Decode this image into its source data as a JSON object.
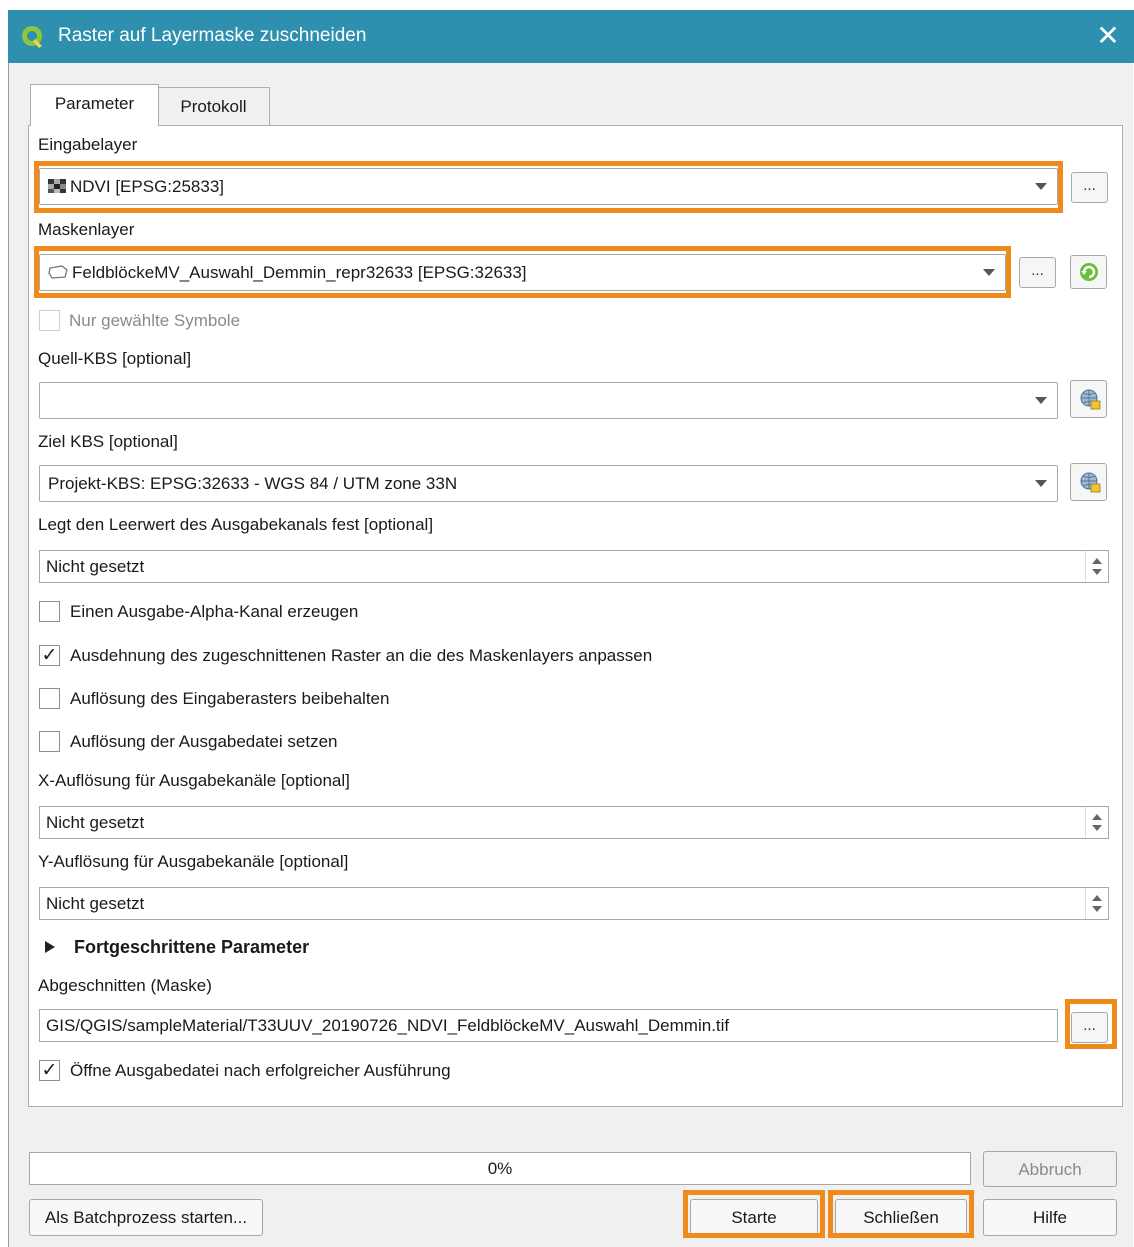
{
  "window": {
    "title": "Raster auf Layermaske zuschneiden",
    "close_glyph": "✕",
    "app_icon": "qgis-logo-icon"
  },
  "tabs": [
    {
      "label": "Parameter",
      "active": true
    },
    {
      "label": "Protokoll",
      "active": false
    }
  ],
  "params": {
    "input_layer": {
      "label": "Eingabelayer",
      "value": "NDVI [EPSG:25833]",
      "icon": "raster-layer-icon"
    },
    "mask_layer": {
      "label": "Maskenlayer",
      "value": "FeldblöckeMV_Auswahl_Demmin_repr32633 [EPSG:32633]",
      "icon": "polygon-layer-icon"
    },
    "selected_only": {
      "label": "Nur gewählte Symbole",
      "checked": false,
      "enabled": false
    },
    "source_crs": {
      "label": "Quell-KBS [optional]",
      "value": ""
    },
    "target_crs": {
      "label": "Ziel KBS [optional]",
      "value": "Projekt-KBS: EPSG:32633 - WGS 84 / UTM zone 33N"
    },
    "nodata": {
      "label": "Legt den Leerwert des Ausgabekanals fest [optional]",
      "value": "Nicht gesetzt"
    },
    "alpha": {
      "label": "Einen Ausgabe-Alpha-Kanal erzeugen",
      "checked": false
    },
    "crop_extent": {
      "label": "Ausdehnung des zugeschnittenen Raster an die des Maskenlayers anpassen",
      "checked": true
    },
    "keep_resolution": {
      "label": "Auflösung des Eingaberasters beibehalten",
      "checked": false
    },
    "set_resolution": {
      "label": "Auflösung der Ausgabedatei setzen",
      "checked": false
    },
    "x_res": {
      "label": "X-Auflösung für Ausgabekanäle [optional]",
      "value": "Nicht gesetzt"
    },
    "y_res": {
      "label": "Y-Auflösung für Ausgabekanäle [optional]",
      "value": "Nicht gesetzt"
    },
    "advanced": {
      "label": "Fortgeschrittene Parameter"
    },
    "output": {
      "label": "Abgeschnitten (Maske)",
      "value": "GIS/QGIS/sampleMaterial/T33UUV_20190726_NDVI_FeldblöckeMV_Auswahl_Demmin.tif"
    },
    "open_output": {
      "label": "Öffne Ausgabedatei nach erfolgreicher Ausführung",
      "checked": true
    }
  },
  "ellipsis": "...",
  "checkmark": "✓",
  "progress": {
    "value": 0,
    "text": "0%"
  },
  "buttons": {
    "cancel": "Abbruch",
    "batch": "Als Batchprozess starten...",
    "run": "Starte",
    "close": "Schließen",
    "help": "Hilfe"
  },
  "colors": {
    "titlebar": "#2f8faf",
    "highlight": "#ef8a1b",
    "panel": "#ffffff",
    "window": "#f0f0f0"
  }
}
